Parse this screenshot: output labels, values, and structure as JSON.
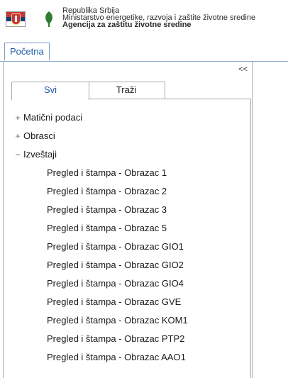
{
  "header": {
    "line1": "Republika Srbija",
    "line2": "Ministarstvo energetike, razvoja i zaštite životne sredine",
    "line3": "Agencija za zaštitu životne sredine"
  },
  "tabs": {
    "home": "Početna"
  },
  "panel": {
    "collapse_label": "<<",
    "subtabs": [
      {
        "label": "Svi",
        "active": true
      },
      {
        "label": "Traži",
        "active": false
      }
    ]
  },
  "tree": {
    "groups": [
      {
        "toggle": "+",
        "label": "Matični podaci"
      },
      {
        "toggle": "+",
        "label": "Obrasci"
      },
      {
        "toggle": "−",
        "label": "Izveštaji"
      }
    ],
    "reports": [
      "Pregled i štampa - Obrazac 1",
      "Pregled i štampa - Obrazac 2",
      "Pregled i štampa - Obrazac 3",
      "Pregled i štampa - Obrazac 5",
      "Pregled i štampa - Obrazac GIO1",
      "Pregled i štampa - Obrazac GIO2",
      "Pregled i štampa - Obrazac GIO4",
      "Pregled i štampa - Obrazac GVE",
      "Pregled i štampa - Obrazac KOM1",
      "Pregled i štampa - Obrazac PTP2",
      "Pregled i štampa - Obrazac AAO1"
    ]
  },
  "colors": {
    "accent": "#1e5aa8",
    "flag_red": "#c6363c",
    "flag_blue": "#0c4076",
    "leaf_green": "#2e7d32"
  },
  "icons": {
    "flag": "serbia-flag-icon",
    "leaf": "leaf-logo-icon"
  }
}
